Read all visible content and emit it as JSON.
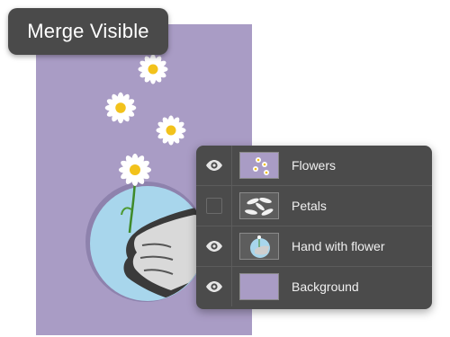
{
  "tooltip": {
    "label": "Merge Visible"
  },
  "canvas": {
    "background_color": "#a99cc5",
    "hole_color": "#a8d6ec"
  },
  "layers_panel": {
    "layers": [
      {
        "name": "Flowers",
        "visible": true,
        "icon": "eye-icon"
      },
      {
        "name": "Petals",
        "visible": false,
        "icon": ""
      },
      {
        "name": "Hand with flower",
        "visible": true,
        "icon": "eye-icon"
      },
      {
        "name": "Background",
        "visible": true,
        "icon": "eye-icon"
      }
    ]
  }
}
